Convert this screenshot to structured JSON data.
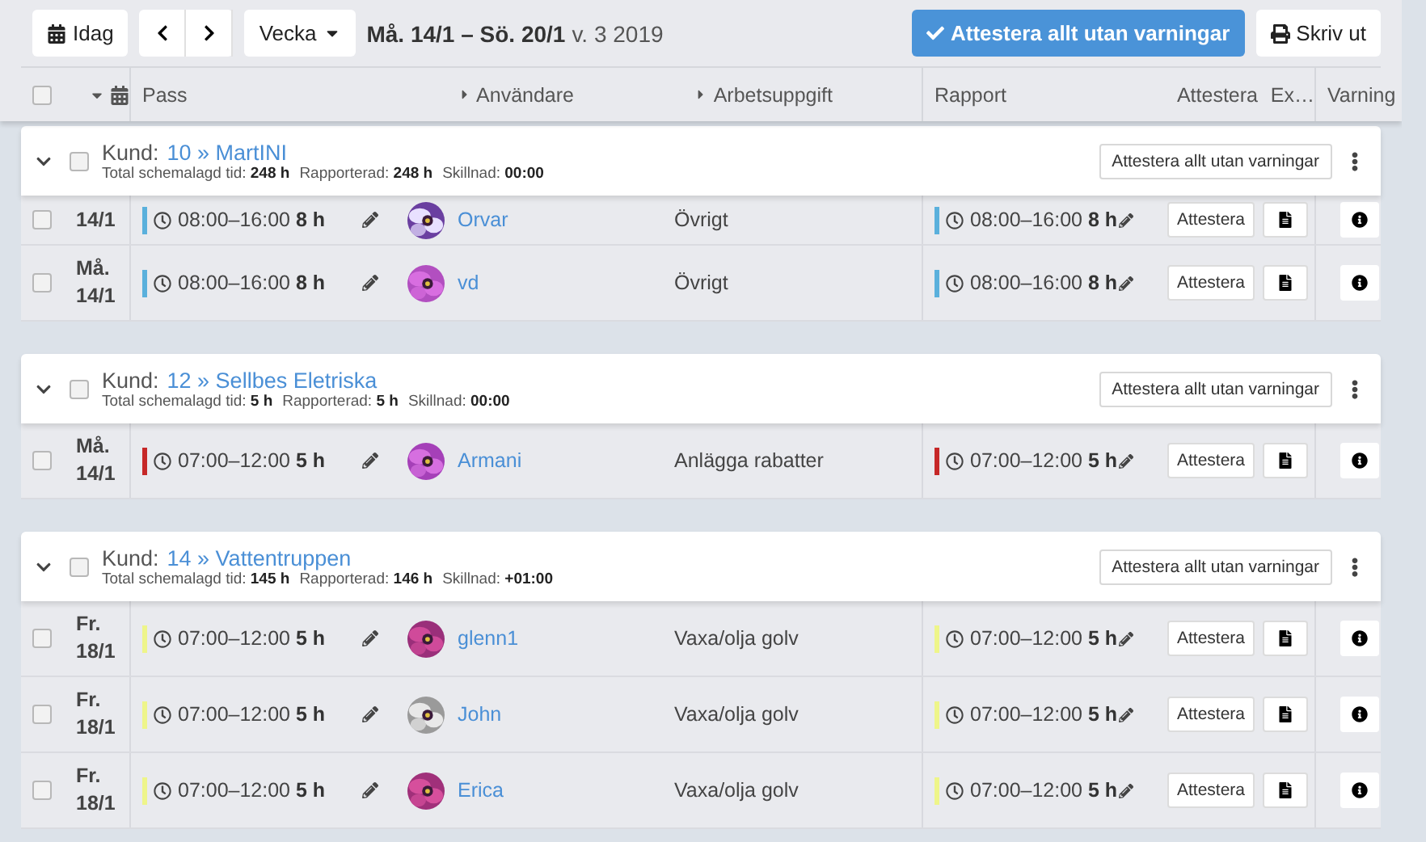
{
  "toolbar": {
    "today": "Idag",
    "view": "Vecka",
    "range": "Må. 14/1 – Sö. 20/1",
    "week": "v. 3 2019",
    "approve_all": "Attestera allt utan varningar",
    "print": "Skriv ut"
  },
  "header": {
    "checked": false,
    "columns": [
      {
        "kind": "text",
        "label": "Pass"
      },
      {
        "kind": "expand",
        "label": "Användare"
      },
      {
        "kind": "expand",
        "label": "Arbetsuppgift"
      },
      {
        "kind": "text",
        "label": "Rapport"
      },
      {
        "kind": "text",
        "label": "Attestera"
      },
      {
        "kind": "text",
        "label": "Ex…"
      },
      {
        "kind": "text",
        "label": "Varning"
      }
    ]
  },
  "groups": [
    {
      "label": "Kund:",
      "name": "10 » MartINI",
      "expanded": true,
      "checked": false,
      "stats": [
        {
          "label": "Total schemalagd tid:",
          "value": "248 h"
        },
        {
          "label": "Rapporterad:",
          "value": "248 h"
        },
        {
          "label": "Skillnad:",
          "value": "00:00"
        }
      ],
      "button": "Attestera allt utan varningar",
      "rows": [
        {
          "date": "14/1",
          "checked": false,
          "color": "#5ab0dc",
          "time": "08:00–16:00",
          "hours": "8 h",
          "user": "Orvar",
          "task": "Övrigt",
          "report_time": "08:00–16:00",
          "report_hours": "8 h",
          "approve": "Attestera"
        },
        {
          "day": "Må.",
          "date": "14/1",
          "checked": false,
          "color": "#5ab0dc",
          "time": "08:00–16:00",
          "hours": "8 h",
          "user": "vd",
          "task": "Övrigt",
          "report_time": "08:00–16:00",
          "report_hours": "8 h",
          "approve": "Attestera"
        }
      ]
    },
    {
      "label": "Kund:",
      "name": "12 » Sellbes Eletriska",
      "expanded": true,
      "checked": false,
      "stats": [
        {
          "label": "Total schemalagd tid:",
          "value": "5 h"
        },
        {
          "label": "Rapporterad:",
          "value": "5 h"
        },
        {
          "label": "Skillnad:",
          "value": "00:00"
        }
      ],
      "button": "Attestera allt utan varningar",
      "rows": [
        {
          "day": "Må.",
          "date": "14/1",
          "checked": false,
          "color": "#c62828",
          "time": "07:00–12:00",
          "hours": "5 h",
          "user": "Armani",
          "task": "Anlägga rabatter",
          "report_time": "07:00–12:00",
          "report_hours": "5 h",
          "approve": "Attestera"
        }
      ]
    },
    {
      "label": "Kund:",
      "name": "14 » Vattentruppen",
      "expanded": true,
      "checked": false,
      "stats": [
        {
          "label": "Total schemalagd tid:",
          "value": "145 h"
        },
        {
          "label": "Rapporterad:",
          "value": "146 h"
        },
        {
          "label": "Skillnad:",
          "value": "+01:00"
        }
      ],
      "button": "Attestera allt utan varningar",
      "rows": [
        {
          "day": "Fr.",
          "date": "18/1",
          "checked": false,
          "color": "#eef58a",
          "time": "07:00–12:00",
          "hours": "5 h",
          "user": "glenn1",
          "task": "Vaxa/olja golv",
          "report_time": "07:00–12:00",
          "report_hours": "5 h",
          "approve": "Attestera"
        },
        {
          "day": "Fr.",
          "date": "18/1",
          "checked": false,
          "color": "#eef58a",
          "time": "07:00–12:00",
          "hours": "5 h",
          "user": "John",
          "task": "Vaxa/olja golv",
          "report_time": "07:00–12:00",
          "report_hours": "5 h",
          "approve": "Attestera"
        },
        {
          "day": "Fr.",
          "date": "18/1",
          "checked": false,
          "color": "#eef58a",
          "time": "07:00–12:00",
          "hours": "5 h",
          "user": "Erica",
          "task": "Vaxa/olja golv",
          "report_time": "07:00–12:00",
          "report_hours": "5 h",
          "approve": "Attestera"
        }
      ]
    }
  ]
}
